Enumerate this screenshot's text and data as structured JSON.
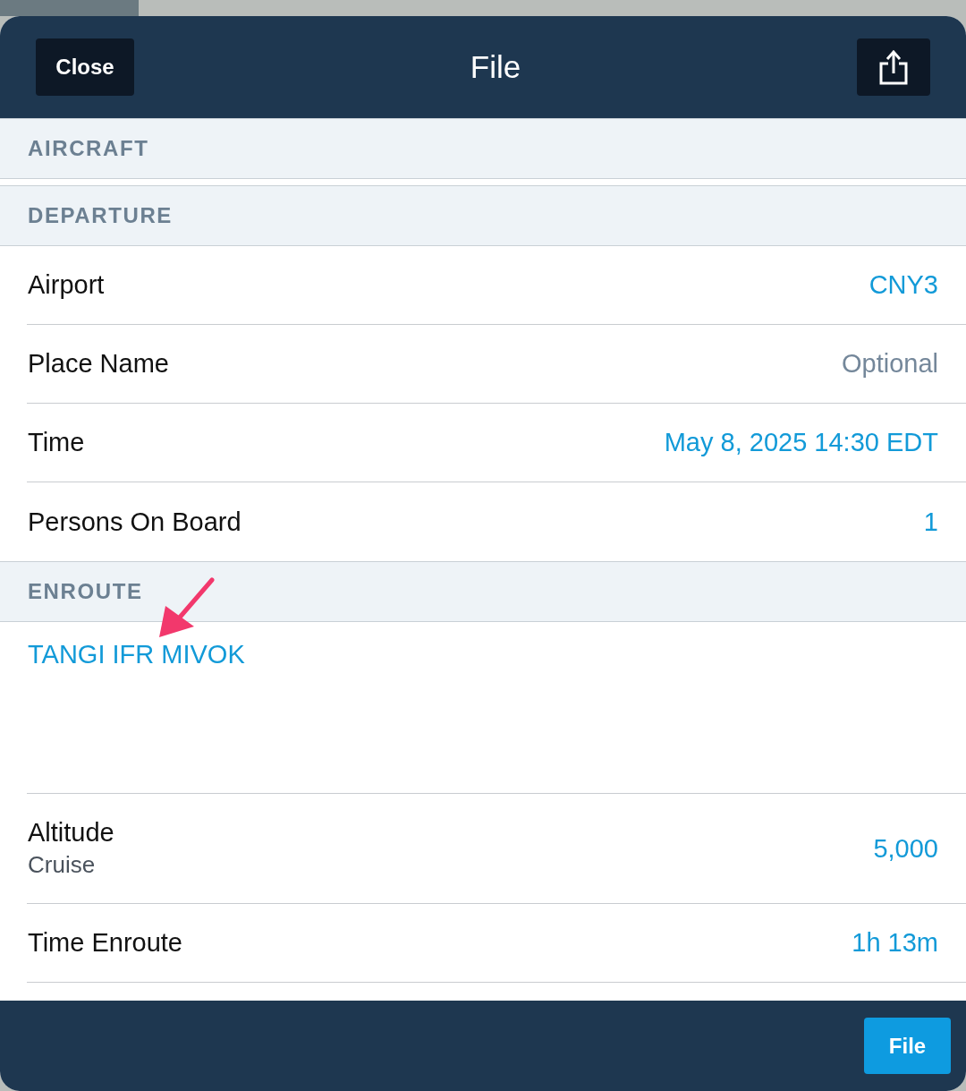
{
  "header": {
    "close_label": "Close",
    "title": "File"
  },
  "sections": [
    {
      "title": "AIRCRAFT"
    },
    {
      "title": "DEPARTURE",
      "rows": [
        {
          "label": "Airport",
          "value": "CNY3"
        },
        {
          "label": "Place Name",
          "placeholder": "Optional"
        },
        {
          "label": "Time",
          "value": "May 8, 2025 14:30 EDT"
        },
        {
          "label": "Persons On Board",
          "value": "1"
        }
      ]
    },
    {
      "title": "ENROUTE",
      "route": "TANGI IFR MIVOK",
      "rows": [
        {
          "label": "Altitude",
          "sublabel": "Cruise",
          "value": "5,000"
        },
        {
          "label": "Time Enroute",
          "value": "1h 13m"
        }
      ]
    }
  ],
  "footer": {
    "button": "File"
  }
}
